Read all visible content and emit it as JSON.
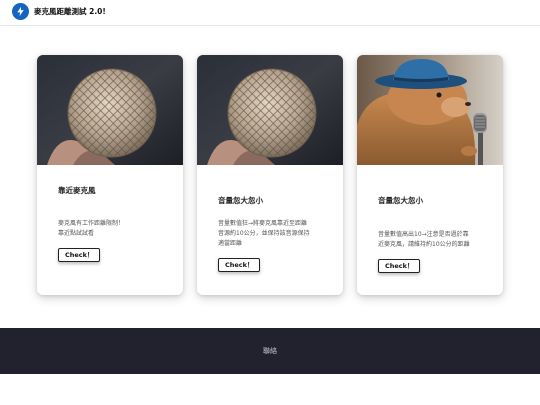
{
  "header": {
    "app_title": "麥克風距離測試 2.0!",
    "logo_icon": "lightning-bolt-icon",
    "brand_color": "#1565c0"
  },
  "cards": [
    {
      "image": "microphone-closeup",
      "title": "靠近麥克風",
      "text_lines": [
        "麥克風有工作距離限制！",
        "靠近點試試看"
      ],
      "button_label": "Check！"
    },
    {
      "image": "microphone-closeup",
      "title": "音量忽大忽小",
      "text_lines": [
        "音量數值狂→將麥克風靠近至距離",
        "音源約10公分，並保持該音源保持",
        "適當距離"
      ],
      "button_label": "Check！"
    },
    {
      "image": "prairie-dog-with-hat-and-microphone",
      "title": "音量忽大忽小",
      "text_lines": [
        "音量數值高出10→注意是否過於靠",
        "近麥克風，請維持約10公分的距離"
      ],
      "button_label": "Check！"
    }
  ],
  "footer": {
    "link_label": "聯絡",
    "background": "#22222e"
  }
}
